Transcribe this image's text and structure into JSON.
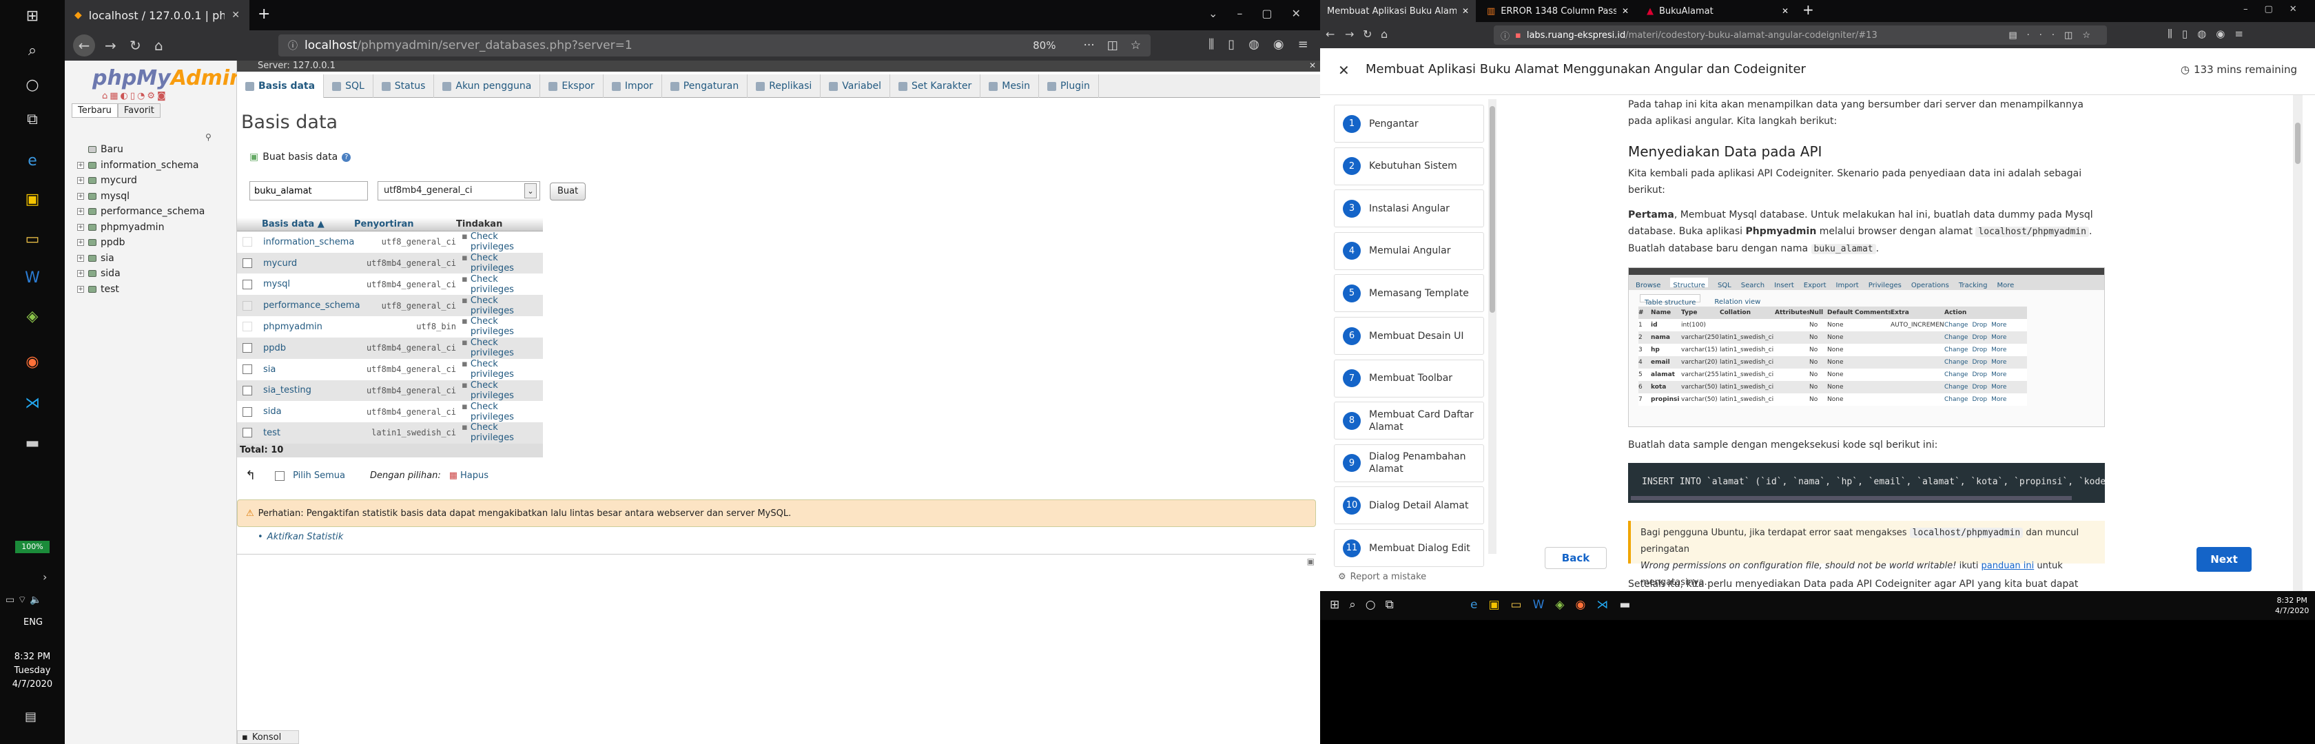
{
  "left_taskbar": {
    "battery": "100%",
    "lang": "ENG",
    "time": "8:32 PM",
    "day": "Tuesday",
    "date": "4/7/2020"
  },
  "left_browser": {
    "tab_title": "localhost / 127.0.0.1 | phpMyA",
    "url_host": "localhost",
    "url_path": "/phpmyadmin/server_databases.php?server=1",
    "zoom": "80%"
  },
  "pma": {
    "logo_main": "phpMy",
    "logo_accent": "Admin",
    "nav_recent": "Terbaru",
    "nav_fav": "Favorit",
    "tree_new": "Baru",
    "tree": [
      "information_schema",
      "mycurd",
      "mysql",
      "performance_schema",
      "phpmyadmin",
      "ppdb",
      "sia",
      "sida",
      "test"
    ],
    "breadcrumb": "Server: 127.0.0.1",
    "tabs": [
      "Basis data",
      "SQL",
      "Status",
      "Akun pengguna",
      "Ekspor",
      "Impor",
      "Pengaturan",
      "Replikasi",
      "Variabel",
      "Set Karakter",
      "Mesin",
      "Plugin"
    ],
    "page_title": "Basis data",
    "create_label": "Buat basis data",
    "create_input": "buku_alamat",
    "create_collation": "utf8mb4_general_ci",
    "create_button": "Buat",
    "col_db": "Basis data",
    "col_collation": "Penyortiran",
    "col_action": "Tindakan",
    "rows": [
      {
        "name": "information_schema",
        "collation": "utf8_general_ci",
        "action": "Check privileges"
      },
      {
        "name": "mycurd",
        "collation": "utf8mb4_general_ci",
        "action": "Check privileges"
      },
      {
        "name": "mysql",
        "collation": "utf8mb4_general_ci",
        "action": "Check privileges"
      },
      {
        "name": "performance_schema",
        "collation": "utf8_general_ci",
        "action": "Check privileges"
      },
      {
        "name": "phpmyadmin",
        "collation": "utf8_bin",
        "action": "Check privileges"
      },
      {
        "name": "ppdb",
        "collation": "utf8mb4_general_ci",
        "action": "Check privileges"
      },
      {
        "name": "sia",
        "collation": "utf8mb4_general_ci",
        "action": "Check privileges"
      },
      {
        "name": "sia_testing",
        "collation": "utf8mb4_general_ci",
        "action": "Check privileges"
      },
      {
        "name": "sida",
        "collation": "utf8mb4_general_ci",
        "action": "Check privileges"
      },
      {
        "name": "test",
        "collation": "latin1_swedish_ci",
        "action": "Check privileges"
      }
    ],
    "total": "Total: 10",
    "select_all": "Pilih Semua",
    "with_selected": "Dengan pilihan:",
    "delete": "Hapus",
    "notice": "Perhatian: Pengaktifan statistik basis data dapat mengakibatkan lalu lintas besar antara webserver dan server MySQL.",
    "enable_stats": "Aktifkan Statistik",
    "console": "Konsol"
  },
  "right_browser": {
    "tabs": [
      "Membuat Aplikasi Buku Alamat M",
      "ERROR 1348 Column Passwo",
      "BukuAlamat"
    ],
    "url_host": "labs.ruang-ekspresi.id",
    "url_path": "/materi/codestory-buku-alamat-angular-codeigniter/#13"
  },
  "course": {
    "title": "Membuat Aplikasi Buku Alamat Menggunakan Angular dan Codeigniter",
    "remaining": "133 mins remaining",
    "steps": [
      {
        "n": "1",
        "label": "Pengantar"
      },
      {
        "n": "2",
        "label": "Kebutuhan Sistem"
      },
      {
        "n": "3",
        "label": "Instalasi Angular"
      },
      {
        "n": "4",
        "label": "Memulai Angular"
      },
      {
        "n": "5",
        "label": "Memasang Template"
      },
      {
        "n": "6",
        "label": "Membuat Desain UI"
      },
      {
        "n": "7",
        "label": "Membuat Toolbar"
      },
      {
        "n": "8",
        "label": "Membuat Card Daftar Alamat"
      },
      {
        "n": "9",
        "label": "Dialog Penambahan Alamat"
      },
      {
        "n": "10",
        "label": "Dialog Detail Alamat"
      },
      {
        "n": "11",
        "label": "Membuat Dialog Edit"
      }
    ],
    "report": "Report a mistake",
    "back": "Back",
    "next": "Next",
    "intro": "Pada tahap ini kita akan menampilkan data yang bersumber dari server dan menampilkannya pada aplikasi angular. Kita langkah berikut:",
    "h2": "Menyediakan Data pada API",
    "p1": "Kita kembali pada aplikasi API Codeigniter. Skenario pada penyediaan data ini adalah sebagai berikut:",
    "p2_bold": "Pertama",
    "p2": ", Membuat Mysql database. Untuk melakukan hal ini, buatlah data dummy pada Mysql database. Buka aplikasi",
    "p2_bold2": "Phpmyadmin",
    "p2b": "melalui browser dengan alamat",
    "p2_code": "localhost/phpmyadmin",
    "p2c": ". Buatlah database baru dengan nama",
    "p2_code2": "buku_alamat",
    "shot_tabs": [
      "Browse",
      "Structure",
      "SQL",
      "Search",
      "Insert",
      "Export",
      "Import",
      "Privileges",
      "Operations",
      "Tracking",
      "More"
    ],
    "shot_sub": [
      "Table structure",
      "Relation view"
    ],
    "shot_head": [
      "#",
      "Name",
      "Type",
      "Collation",
      "Attributes",
      "Null",
      "Default",
      "Comments",
      "Extra",
      "Action"
    ],
    "shot_rows": [
      [
        "1",
        "id",
        "int(100)",
        "",
        "",
        "No",
        "None",
        "",
        "AUTO_INCREMENT"
      ],
      [
        "2",
        "nama",
        "varchar(250)",
        "latin1_swedish_ci",
        "",
        "No",
        "None",
        "",
        ""
      ],
      [
        "3",
        "hp",
        "varchar(15)",
        "latin1_swedish_ci",
        "",
        "No",
        "None",
        "",
        ""
      ],
      [
        "4",
        "email",
        "varchar(20)",
        "latin1_swedish_ci",
        "",
        "No",
        "None",
        "",
        ""
      ],
      [
        "5",
        "alamat",
        "varchar(255)",
        "latin1_swedish_ci",
        "",
        "No",
        "None",
        "",
        ""
      ],
      [
        "6",
        "kota",
        "varchar(50)",
        "latin1_swedish_ci",
        "",
        "No",
        "None",
        "",
        ""
      ],
      [
        "7",
        "propinsi",
        "varchar(50)",
        "latin1_swedish_ci",
        "",
        "No",
        "None",
        "",
        ""
      ]
    ],
    "shot_actions": [
      "Change",
      "Drop",
      "More"
    ],
    "p3": "Buatlah data sample dengan mengeksekusi kode sql berikut ini:",
    "code_line": "INSERT INTO `alamat` (`id`, `nama`, `hp`, `email`, `alamat`, `kota`, `propinsi`, `kodepo",
    "warn_a": "Bagi pengguna Ubuntu, jika terdapat error saat mengakses",
    "warn_code": "localhost/phpmyadmin",
    "warn_b": "dan muncul peringatan",
    "warn_italic": "Wrong permissions on configuration file, should not be world writable!",
    "warn_c": "ikuti",
    "warn_link": "panduan ini",
    "warn_d": "untuk mengatasinya.",
    "p4": "Setelah itu, kita perlu menyediakan Data pada API Codeigniter agar API yang kita buat dapat membaca data yang"
  },
  "right_taskbar": {
    "time": "8:32 PM",
    "date": "4/7/2020"
  },
  "colors": {
    "pma_link": "#235a81",
    "course_blue": "#1464c8",
    "warn_bg": "#fdf6e3",
    "warn_border": "#f0a500"
  }
}
